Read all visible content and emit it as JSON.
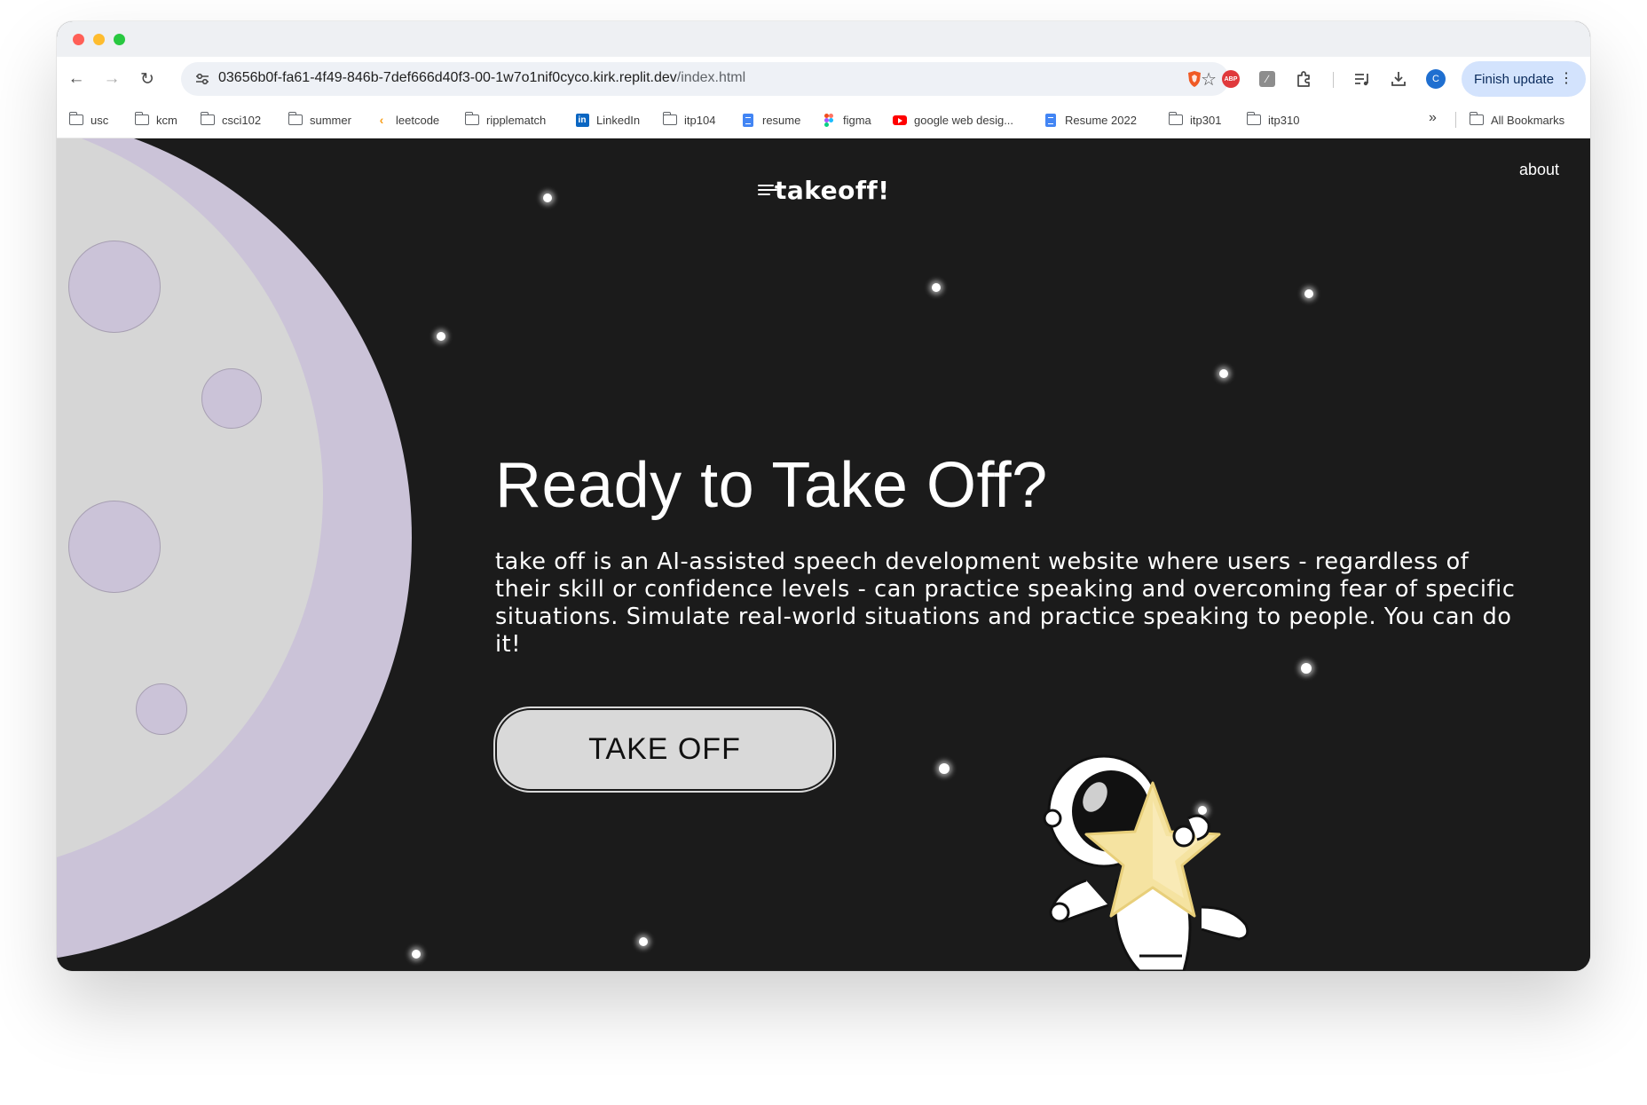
{
  "browser": {
    "url_host": "03656b0f-fa61-4f49-846b-7def666d40f3-00-1w7o1nif0cyco.kirk.replit.dev",
    "url_path": "/index.html",
    "finish_update_label": "Finish update",
    "avatar_letter": "C",
    "abp_label": "ABP"
  },
  "bookmarks": {
    "items": [
      {
        "label": "usc",
        "icon": "folder-icon"
      },
      {
        "label": "kcm",
        "icon": "folder-icon"
      },
      {
        "label": "csci102",
        "icon": "folder-icon"
      },
      {
        "label": "summer",
        "icon": "folder-icon"
      },
      {
        "label": "leetcode",
        "icon": "leetcode-icon"
      },
      {
        "label": "ripplematch",
        "icon": "folder-icon"
      },
      {
        "label": "LinkedIn",
        "icon": "linkedin-icon"
      },
      {
        "label": "itp104",
        "icon": "folder-icon"
      },
      {
        "label": "resume",
        "icon": "docs-icon"
      },
      {
        "label": "figma",
        "icon": "figma-icon"
      },
      {
        "label": "google web desig...",
        "icon": "youtube-icon"
      },
      {
        "label": "Resume 2022",
        "icon": "docs-icon"
      },
      {
        "label": "itp301",
        "icon": "folder-icon"
      },
      {
        "label": "itp310",
        "icon": "folder-icon"
      }
    ],
    "all_bookmarks_label": "All Bookmarks"
  },
  "site": {
    "logo": "takeoff!",
    "nav_about": "about",
    "hero_title": "Ready to Take Off?",
    "hero_body": "take off is an AI-assisted speech development website where users - regardless of their skill or confidence levels - can practice speaking and overcoming fear of specific situations. Simulate real-world situations and practice speaking to people. You can do it!",
    "cta_label": "TAKE OFF"
  },
  "colors": {
    "page_background": "#1b1b1b",
    "moon": "#d6d6d6",
    "moon_shadow": "#cbc3d8",
    "cta_background": "#d9d9d9",
    "update_button": "#d3e3fd"
  }
}
